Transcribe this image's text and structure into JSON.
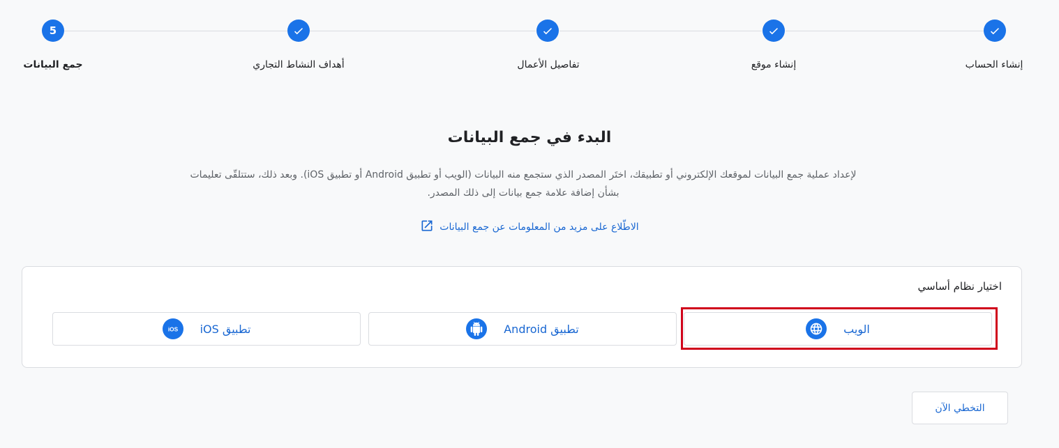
{
  "stepper": {
    "steps": [
      {
        "label": "إنشاء الحساب",
        "state": "done"
      },
      {
        "label": "إنشاء موقع",
        "state": "done"
      },
      {
        "label": "تفاصيل الأعمال",
        "state": "done"
      },
      {
        "label": "أهداف النشاط التجاري",
        "state": "done"
      },
      {
        "label": "جمع البيانات",
        "state": "current",
        "number": "5"
      }
    ],
    "accent_color": "#1a73e8"
  },
  "header": {
    "title": "البدء في جمع البيانات",
    "description_line1": "لإعداد عملية جمع البيانات لموقعك الإلكتروني أو تطبيقك، اختَر المصدر الذي ستجمع منه البيانات (الويب أو تطبيق Android أو تطبيق iOS). وبعد ذلك، ستتلقّى تعليمات",
    "description_line2": "بشأن إضافة علامة جمع بيانات إلى ذلك المصدر.",
    "learn_more_link": "الاطّلاع على مزيد من المعلومات عن جمع البيانات",
    "link_icon": "open-in-new-icon"
  },
  "platform_card": {
    "title": "اختيار نظام أساسي",
    "options": [
      {
        "label": "الويب",
        "icon": "globe-icon",
        "selected_highlight": true
      },
      {
        "label": "تطبيق Android",
        "icon": "android-icon"
      },
      {
        "label": "تطبيق iOS",
        "icon": "ios-icon"
      }
    ],
    "highlight_color": "#d0021b"
  },
  "footer": {
    "skip_label": "التخطي الآن"
  }
}
